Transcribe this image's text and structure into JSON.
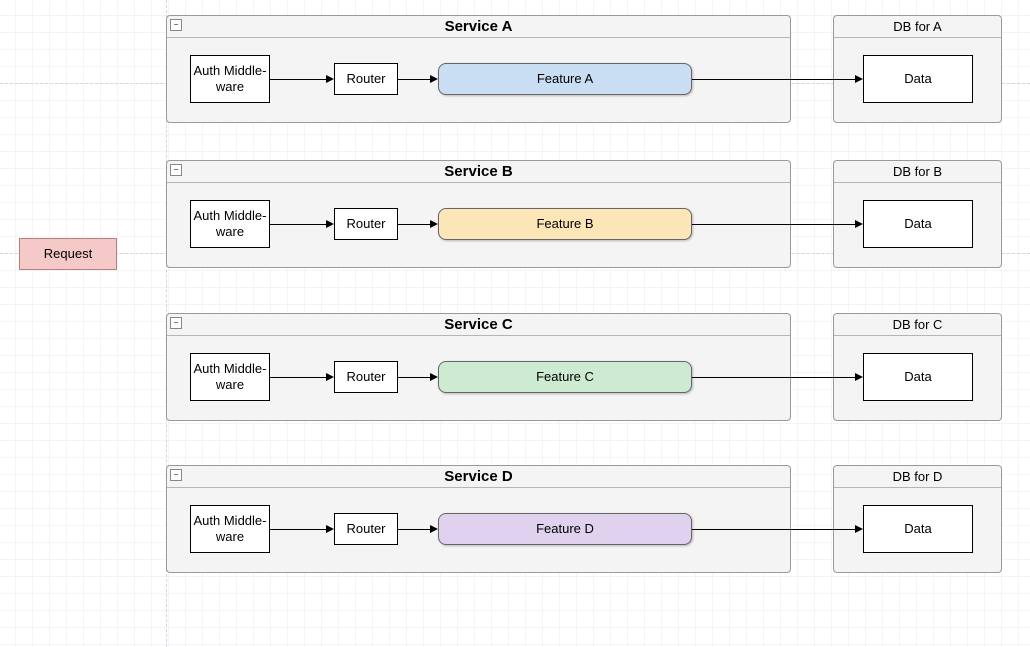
{
  "request_label": "Request",
  "services": [
    {
      "title": "Service A",
      "auth": "Auth Middle-\nware",
      "router": "Router",
      "feature": "Feature A",
      "feature_bg": "#c9def2",
      "db_title": "DB for A",
      "db_data": "Data"
    },
    {
      "title": "Service B",
      "auth": "Auth Middle-\nware",
      "router": "Router",
      "feature": "Feature B",
      "feature_bg": "#fce6b7",
      "db_title": "DB for B",
      "db_data": "Data"
    },
    {
      "title": "Service C",
      "auth": "Auth Middle-\nware",
      "router": "Router",
      "feature": "Feature C",
      "feature_bg": "#ccebd0",
      "db_title": "DB for C",
      "db_data": "Data"
    },
    {
      "title": "Service D",
      "auth": "Auth Middle-\nware",
      "router": "Router",
      "feature": "Feature D",
      "feature_bg": "#e0d2ef",
      "db_title": "DB for D",
      "db_data": "Data"
    }
  ]
}
